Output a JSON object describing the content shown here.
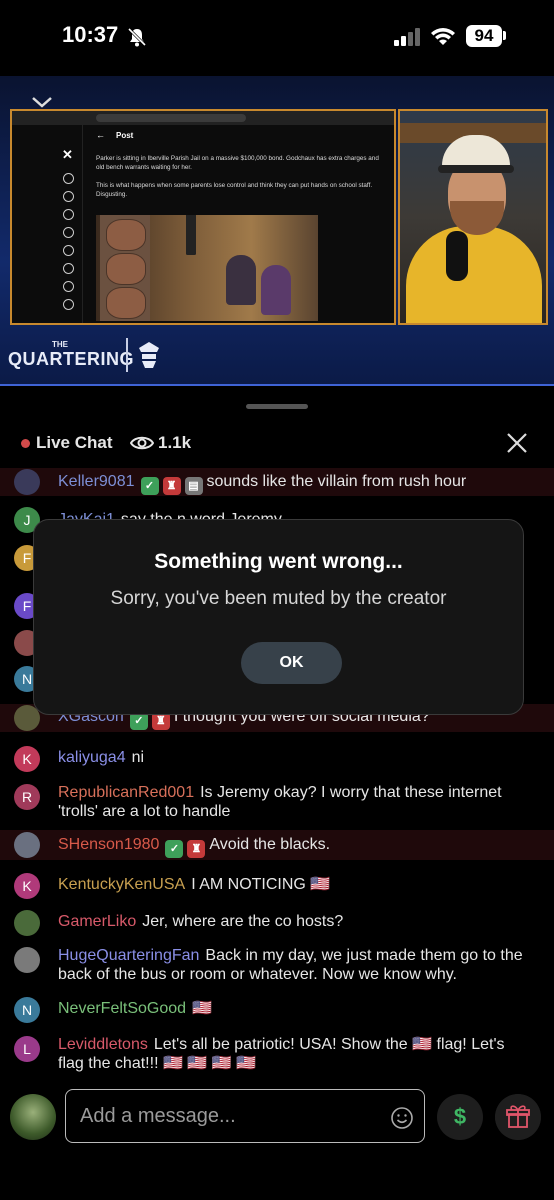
{
  "status_bar": {
    "time": "10:37",
    "battery": "94"
  },
  "video": {
    "post_header": "Post",
    "post_text": "Parker is sitting in Iberville Parish Jail on a massive $100,000 bond. Godchaux has extra charges and old bench warrants waiting for her.\n\nThis is what happens when some parents lose control and think they can put hands on school staff. Disgusting.",
    "logo_the": "THE",
    "logo_name": "QUARTERING"
  },
  "chat_header": {
    "title": "Live Chat",
    "viewers": "1.1k"
  },
  "modal": {
    "title": "Something went wrong...",
    "body": "Sorry, you've been muted by the creator",
    "ok": "OK"
  },
  "messages": [
    {
      "avatar": "",
      "avatar_color": "#3a3a5a",
      "name": "Keller9081",
      "name_color": "#7d8fd6",
      "badges": [
        "green",
        "red",
        "gray"
      ],
      "text": "sounds like the villain from rush hour",
      "highlight": true
    },
    {
      "avatar": "J",
      "avatar_color": "#3d8a4a",
      "name": "JayKai1",
      "name_color": "#7d8fd6",
      "badges": [],
      "text": "say the n word Jeremy",
      "highlight": false
    },
    {
      "avatar": "K",
      "avatar_color": "#c23a5a",
      "name": "kaliyuga4",
      "name_color": "#8a8fe6",
      "badges": [],
      "text": "ni",
      "highlight": false
    },
    {
      "avatar": "R",
      "avatar_color": "#a03a5a",
      "name": "RepublicanRed001",
      "name_color": "#d8705a",
      "badges": [],
      "text": "Is Jeremy okay? I worry that these internet 'trolls' are a lot to handle",
      "highlight": false
    },
    {
      "avatar": "",
      "avatar_color": "#6a7080",
      "name": "SHenson1980",
      "name_color": "#d85a4a",
      "badges": [
        "green",
        "red"
      ],
      "text": "Avoid the blacks.",
      "highlight": true
    },
    {
      "avatar": "K",
      "avatar_color": "#b03a7a",
      "name": "KentuckyKenUSA",
      "name_color": "#c8a050",
      "badges": [],
      "text": "I AM NOTICING 🇺🇸",
      "highlight": false
    },
    {
      "avatar": "",
      "avatar_color": "#4a6a3a",
      "name": "GamerLiko",
      "name_color": "#d85a6a",
      "badges": [],
      "text": "Jer, where are the co hosts?",
      "highlight": false
    },
    {
      "avatar": "",
      "avatar_color": "#7a7a7a",
      "name": "HugeQuarteringFan",
      "name_color": "#8a8fe6",
      "badges": [],
      "text": "Back in my day, we just made them go to the back of the bus or room or whatever. Now we know why.",
      "highlight": false
    },
    {
      "avatar": "N",
      "avatar_color": "#3a7a9a",
      "name": "NeverFeltSoGood",
      "name_color": "#7ac07a",
      "badges": [],
      "text": "🇺🇸",
      "highlight": false
    },
    {
      "avatar": "L",
      "avatar_color": "#9a3a8a",
      "name": "Leviddletons",
      "name_color": "#d85a6a",
      "badges": [],
      "text": "Let's all be patriotic! USA! Show the 🇺🇸 flag! Let's flag the chat!!! 🇺🇸 🇺🇸 🇺🇸 🇺🇸",
      "highlight": false
    }
  ],
  "partial_messages": [
    {
      "avatar": "F",
      "avatar_color": "#c89a3a"
    },
    {
      "avatar": "F",
      "avatar_color": "#6a4ac8"
    },
    {
      "avatar": "",
      "avatar_color": "#8a4a4a"
    },
    {
      "avatar": "N",
      "avatar_color": "#3a7a9a"
    }
  ],
  "blocked_message": {
    "name": "XGascon",
    "name_color": "#7d8fd6",
    "text": "I thought you were off social media?"
  },
  "input": {
    "placeholder": "Add a message...",
    "dollar": "$"
  }
}
